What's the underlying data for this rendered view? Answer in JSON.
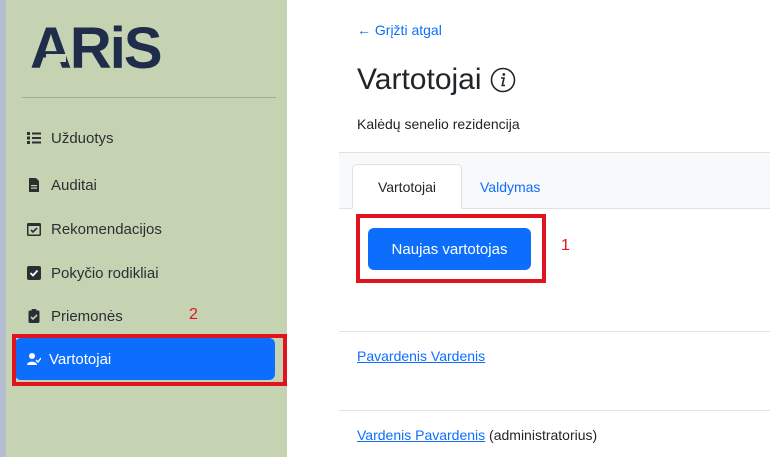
{
  "sidebar": {
    "logo_text": "ARiS",
    "items": [
      {
        "label": "Užduotys",
        "icon": "list-icon"
      },
      {
        "label": "Auditai",
        "icon": "file-icon"
      },
      {
        "label": "Rekomendacijos",
        "icon": "calendar-check-icon"
      },
      {
        "label": "Pokyčio rodikliai",
        "icon": "checkbox-icon"
      },
      {
        "label": "Priemonės",
        "icon": "clipboard-check-icon"
      }
    ],
    "active_item": {
      "label": "Vartotojai",
      "icon": "user-check-icon"
    }
  },
  "annotations": {
    "marker_1": "1",
    "marker_2": "2",
    "color": "#e0141e"
  },
  "main": {
    "back_link": "← Grįžti atgal",
    "title": "Vartotojai",
    "subtitle": "Kalėdų senelio rezidencija",
    "tabs": [
      {
        "label": "Vartotojai",
        "active": true
      },
      {
        "label": "Valdymas",
        "active": false
      }
    ],
    "new_user_button": "Naujas vartotojas",
    "users": [
      {
        "name": "Pavardenis Vardenis",
        "role": ""
      },
      {
        "name": "Vardenis Pavardenis",
        "role": "(administratorius)"
      }
    ]
  },
  "colors": {
    "accent": "#0d6efd",
    "sidebar_bg": "#c5d3b3",
    "logo": "#1f2d4a"
  }
}
